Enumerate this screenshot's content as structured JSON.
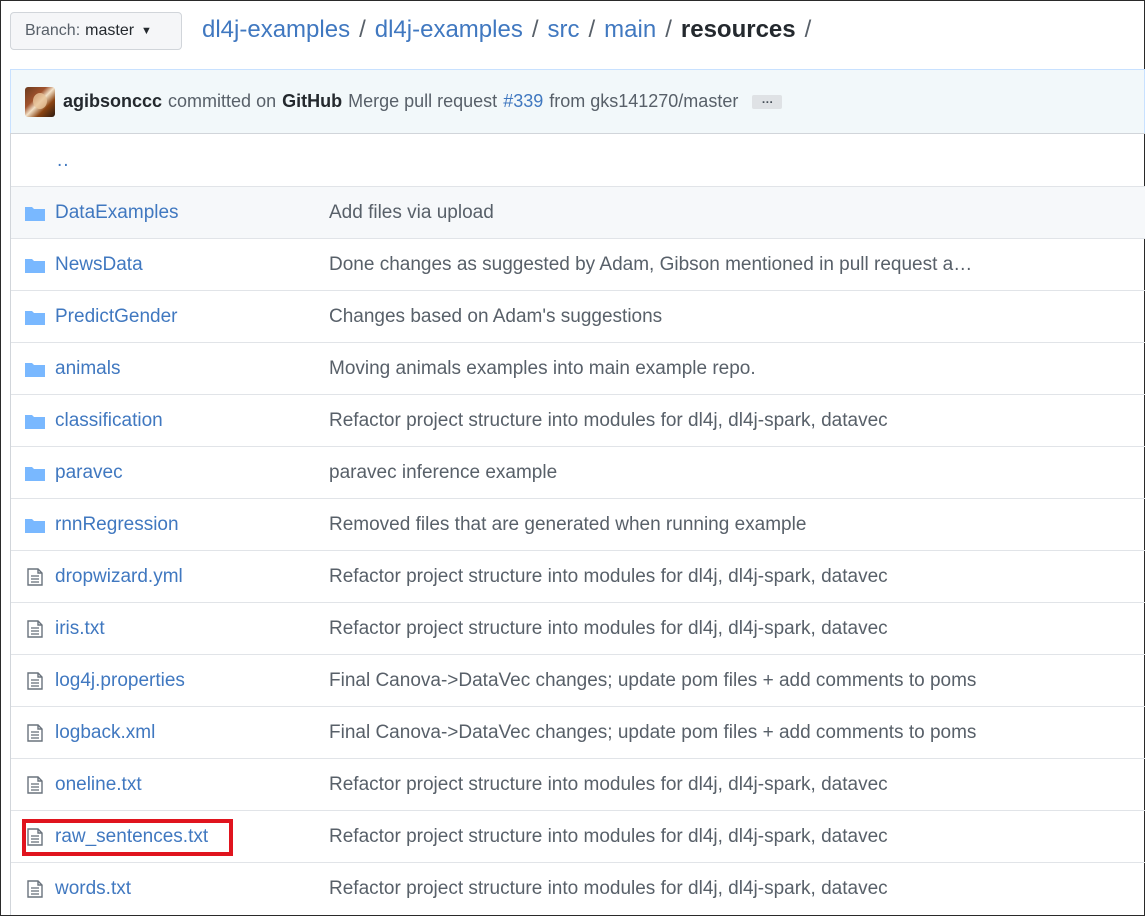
{
  "branch": {
    "label": "Branch:",
    "value": "master"
  },
  "breadcrumb": {
    "repo": "dl4j-examples",
    "parts": [
      "dl4j-examples",
      "src",
      "main"
    ],
    "current": "resources",
    "separator": "/"
  },
  "commit": {
    "user": "agibsonccc",
    "verb": "committed on",
    "platform": "GitHub",
    "message_start": "Merge pull request",
    "pr": "#339",
    "message_end": "from gks141270/master",
    "more": "…"
  },
  "parent_dir": "..",
  "files": [
    {
      "name": "DataExamples",
      "type": "folder",
      "message": "Add files via upload",
      "highlight": true
    },
    {
      "name": "NewsData",
      "type": "folder",
      "message": "Done changes as suggested by Adam, Gibson mentioned in pull request a…"
    },
    {
      "name": "PredictGender",
      "type": "folder",
      "message": "Changes based on Adam's suggestions"
    },
    {
      "name": "animals",
      "type": "folder",
      "message": "Moving animals examples into main example repo."
    },
    {
      "name": "classification",
      "type": "folder",
      "message": "Refactor project structure into modules for dl4j, dl4j-spark, datavec"
    },
    {
      "name": "paravec",
      "type": "folder",
      "message": "paravec inference example"
    },
    {
      "name": "rnnRegression",
      "type": "folder",
      "message": "Removed files that are generated when running example"
    },
    {
      "name": "dropwizard.yml",
      "type": "file",
      "message": "Refactor project structure into modules for dl4j, dl4j-spark, datavec"
    },
    {
      "name": "iris.txt",
      "type": "file",
      "message": "Refactor project structure into modules for dl4j, dl4j-spark, datavec"
    },
    {
      "name": "log4j.properties",
      "type": "file",
      "message": "Final Canova->DataVec changes; update pom files + add comments to poms"
    },
    {
      "name": "logback.xml",
      "type": "file",
      "message": "Final Canova->DataVec changes; update pom files + add comments to poms"
    },
    {
      "name": "oneline.txt",
      "type": "file",
      "message": "Refactor project structure into modules for dl4j, dl4j-spark, datavec"
    },
    {
      "name": "raw_sentences.txt",
      "type": "file",
      "message": "Refactor project structure into modules for dl4j, dl4j-spark, datavec",
      "annotated": true
    },
    {
      "name": "words.txt",
      "type": "file",
      "message": "Refactor project structure into modules for dl4j, dl4j-spark, datavec"
    }
  ],
  "colors": {
    "link": "#4078c0",
    "folder": "#79b8ff",
    "annotation": "#e0141e"
  }
}
